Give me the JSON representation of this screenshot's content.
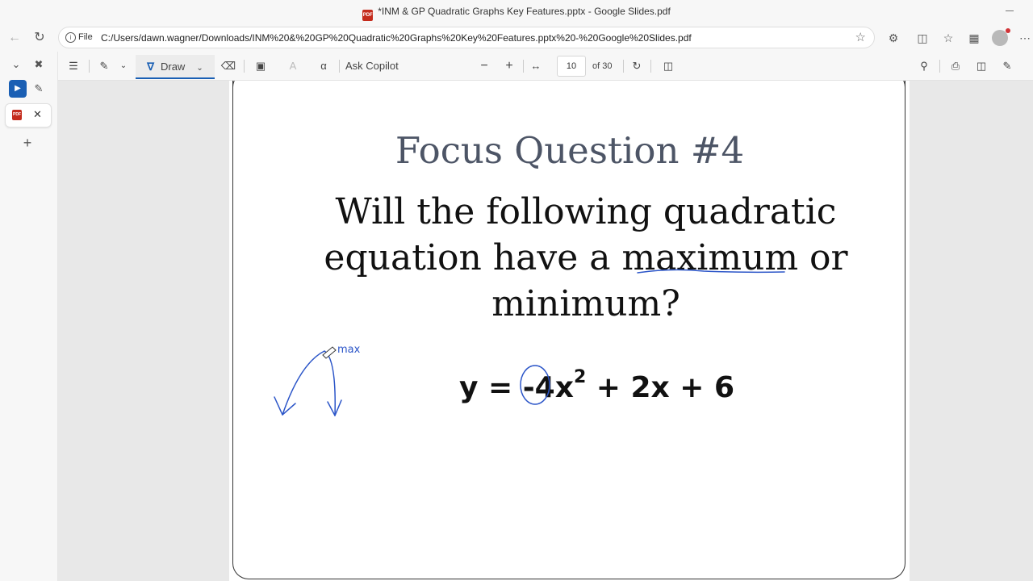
{
  "window": {
    "title": "*INM & GP Quadratic Graphs Key Features.pptx - Google Slides.pdf"
  },
  "address": {
    "file_label": "File",
    "url": "C:/Users/dawn.wagner/Downloads/INM%20&%20GP%20Quadratic%20Graphs%20Key%20Features.pptx%20-%20Google%20Slides.pdf"
  },
  "toolbar": {
    "draw_label": "Draw",
    "ask_copilot_label": "Ask Copilot",
    "page_current": "10",
    "page_total": "of 30"
  },
  "slide": {
    "title": "Focus Question #4",
    "question_line1": "Will the following quadratic",
    "question_line2_pre": "equation have a ",
    "question_line2_word": "maximum",
    "question_line2_post": " or",
    "question_line3": "minimum?",
    "eq_lhs": "y = ",
    "eq_coef": "-4",
    "eq_var": "x",
    "eq_exp": "2",
    "eq_rest": " + 2x + 6",
    "annotation_max": "max"
  },
  "colors": {
    "ink": "#2b55c8",
    "accent": "#1a5fb4",
    "pdf_red": "#c42b1c"
  },
  "icons": {
    "back": "arrow-left-icon",
    "reload": "refresh-icon",
    "favorite": "star-icon",
    "extensions": "puzzle-icon",
    "split": "split-screen-icon",
    "favorites": "favorites-icon",
    "collections": "collections-icon",
    "more": "more-icon"
  }
}
